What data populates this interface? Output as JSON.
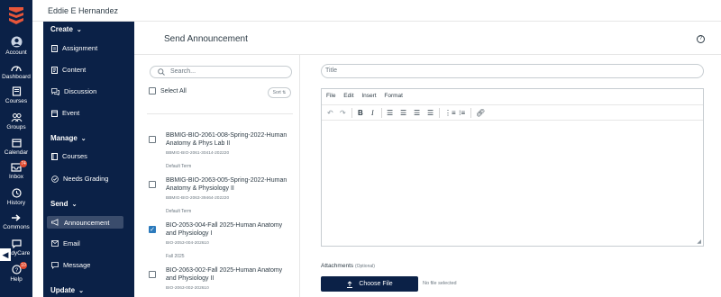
{
  "user": {
    "name": "Eddie E Hernandez"
  },
  "global_nav": [
    {
      "label": "Account",
      "icon": "account-icon"
    },
    {
      "label": "Dashboard",
      "icon": "dashboard-icon"
    },
    {
      "label": "Courses",
      "icon": "courses-icon"
    },
    {
      "label": "Groups",
      "icon": "groups-icon"
    },
    {
      "label": "Calendar",
      "icon": "calendar-icon"
    },
    {
      "label": "Inbox",
      "icon": "inbox-icon",
      "badge": "74"
    },
    {
      "label": "History",
      "icon": "history-icon"
    },
    {
      "label": "Commons",
      "icon": "commons-icon"
    },
    {
      "label": "ReadyCare",
      "icon": "readycare-icon",
      "visible_text": "adyCare"
    },
    {
      "label": "Help",
      "icon": "help-icon",
      "badge": "10"
    }
  ],
  "course_nav": {
    "create_label": "Create",
    "create_items": [
      "Assignment",
      "Content",
      "Discussion",
      "Event"
    ],
    "manage_label": "Manage",
    "manage_items": [
      "Courses",
      "Needs Grading"
    ],
    "send_label": "Send",
    "send_items": [
      "Announcement",
      "Email",
      "Message"
    ],
    "update_label": "Update",
    "active_item": "Announcement"
  },
  "page": {
    "title": "Send Announcement",
    "help": "?"
  },
  "search": {
    "placeholder": "Search..."
  },
  "select_all": "Select All",
  "sort_label": "Sort ⇅",
  "courses": [
    {
      "name": "BBMIG-BIO-2061-008-Spring-2022-Human Anatomy & Phys Lab II",
      "code": "BBMIG-BIO-2061-30414-202220",
      "term": "Default Term",
      "checked": false
    },
    {
      "name": "BBMIG-BIO-2063-005-Spring-2022-Human Anatomy & Physiology II",
      "code": "BBMIG-BIO-2063-39464-202220",
      "term": "Default Term",
      "checked": false
    },
    {
      "name": "BIO-2053-004-Fall 2025-Human Anatomy and Physiology I",
      "code": "BIO-2053-004-202610",
      "term": "Fall 2025",
      "checked": true
    },
    {
      "name": "BIO-2063-002-Fall 2025-Human Anatomy and Physiology II",
      "code": "BIO-2063-002-202610",
      "term": "",
      "checked": false
    }
  ],
  "composer": {
    "title_placeholder": "Title",
    "menu": [
      "File",
      "Edit",
      "Insert",
      "Format"
    ],
    "attachments_label": "Attachments",
    "attachments_optional": "(Optional)",
    "choose_file": "Choose File",
    "no_file": "No file selected"
  },
  "colors": {
    "nav_bg": "#0b2147",
    "accent": "#2b7abc",
    "badge": "#e0492e"
  }
}
